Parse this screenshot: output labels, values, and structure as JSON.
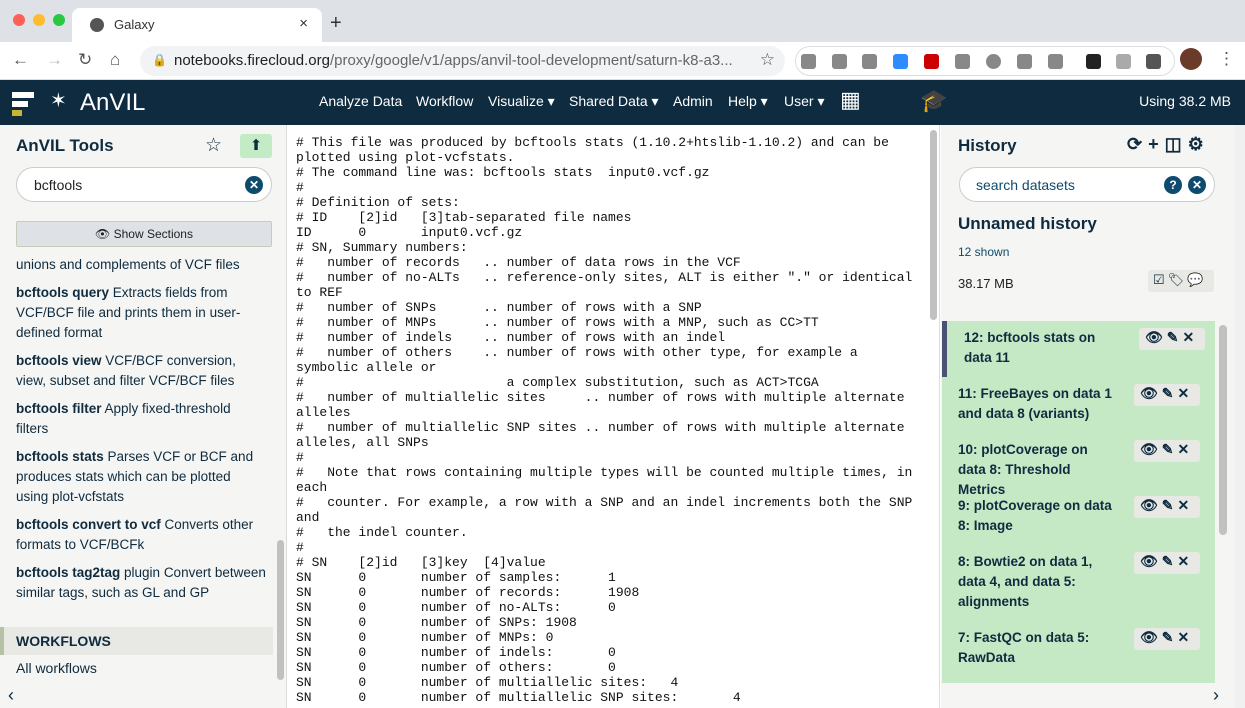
{
  "browser": {
    "tab_title": "Galaxy",
    "url_host": "notebooks.firecloud.org",
    "url_path": "/proxy/google/v1/apps/anvil-tool-development/saturn-k8-a3..."
  },
  "masthead": {
    "brand": "AnVIL",
    "menu": [
      "Analyze Data",
      "Workflow",
      "Visualize ▾",
      "Shared Data ▾",
      "Admin",
      "Help ▾",
      "User ▾"
    ],
    "usage": "Using 38.2 MB"
  },
  "tool_panel": {
    "title": "AnVIL Tools",
    "search_value": "bcftools",
    "show_sections": "Show Sections",
    "tools": [
      {
        "name": "",
        "desc": "unions and complements of VCF files"
      },
      {
        "name": "bcftools query",
        "desc": "Extracts fields from VCF/BCF file and prints them in user-defined format"
      },
      {
        "name": "bcftools view",
        "desc": "VCF/BCF conversion, view, subset and filter VCF/BCF files"
      },
      {
        "name": "bcftools filter",
        "desc": "Apply fixed-threshold filters"
      },
      {
        "name": "bcftools stats",
        "desc": "Parses VCF or BCF and produces stats which can be plotted using plot-vcfstats"
      },
      {
        "name": "bcftools convert to vcf",
        "desc": "Converts other formats to VCF/BCFk"
      },
      {
        "name": "bcftools tag2tag",
        "desc": "plugin Convert between similar tags, such as GL and GP"
      }
    ],
    "section": "WORKFLOWS",
    "all_workflows": "All workflows"
  },
  "center": {
    "lines": [
      "# This file was produced by bcftools stats (1.10.2+htslib-1.10.2) and can be",
      "plotted using plot-vcfstats.",
      "# The command line was: bcftools stats  input0.vcf.gz",
      "#",
      "# Definition of sets:",
      "# ID    [2]id   [3]tab-separated file names",
      "ID      0       input0.vcf.gz",
      "# SN, Summary numbers:",
      "#   number of records   .. number of data rows in the VCF",
      "#   number of no-ALTs   .. reference-only sites, ALT is either \".\" or identical",
      "to REF",
      "#   number of SNPs      .. number of rows with a SNP",
      "#   number of MNPs      .. number of rows with a MNP, such as CC>TT",
      "#   number of indels    .. number of rows with an indel",
      "#   number of others    .. number of rows with other type, for example a",
      "symbolic allele or",
      "#                          a complex substitution, such as ACT>TCGA",
      "#   number of multiallelic sites     .. number of rows with multiple alternate",
      "alleles",
      "#   number of multiallelic SNP sites .. number of rows with multiple alternate",
      "alleles, all SNPs",
      "#",
      "#   Note that rows containing multiple types will be counted multiple times, in",
      "each",
      "#   counter. For example, a row with a SNP and an indel increments both the SNP",
      "and",
      "#   the indel counter.",
      "#",
      "# SN    [2]id   [3]key  [4]value",
      "SN      0       number of samples:      1",
      "SN      0       number of records:      1908",
      "SN      0       number of no-ALTs:      0",
      "SN      0       number of SNPs: 1908",
      "SN      0       number of MNPs: 0",
      "SN      0       number of indels:       0",
      "SN      0       number of others:       0",
      "SN      0       number of multiallelic sites:   4",
      "SN      0       number of multiallelic SNP sites:       4"
    ]
  },
  "history": {
    "title": "History",
    "search_placeholder": "search datasets",
    "name": "Unnamed history",
    "shown": "12 shown",
    "size": "38.17 MB",
    "datasets": [
      "12: bcftools stats on data 11",
      "11: FreeBayes on data 1 and data 8 (variants)",
      "10: plotCoverage on data 8: Threshold Metrics",
      "9: plotCoverage on data 8: Image",
      "8: Bowtie2 on data 1, data 4, and data 5: alignments",
      "7: FastQC on data 5: RawData"
    ],
    "dataset_color": "#c5e9c5"
  }
}
